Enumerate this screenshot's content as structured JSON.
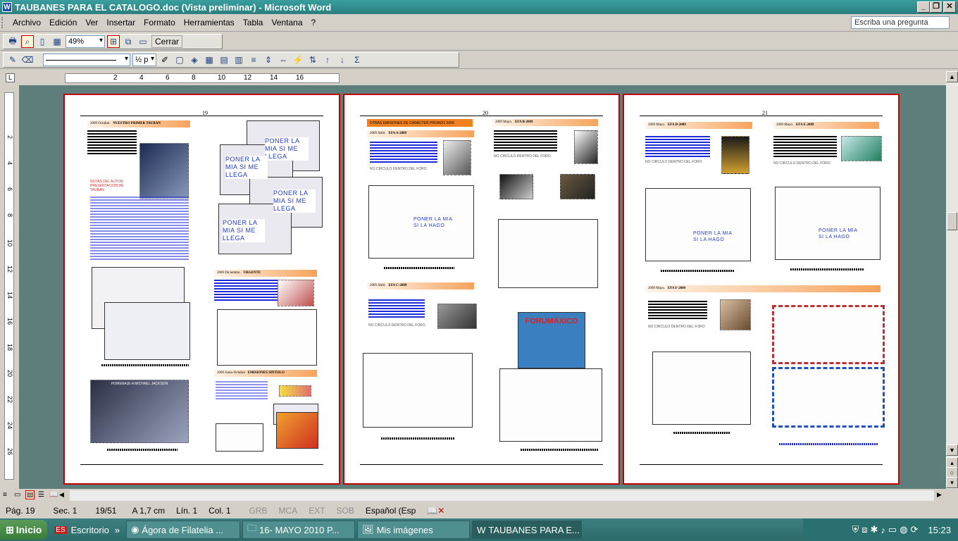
{
  "window": {
    "title": "TAUBANES PARA EL CATALOGO.doc (Vista preliminar) - Microsoft Word",
    "app_icon": "W"
  },
  "menu": [
    "Archivo",
    "Edición",
    "Ver",
    "Insertar",
    "Formato",
    "Herramientas",
    "Tabla",
    "Ventana",
    "?"
  ],
  "help_box": {
    "placeholder": "Escriba una pregunta"
  },
  "toolbar1": {
    "zoom": "49%",
    "close_label": "Cerrar"
  },
  "toolbar2": {
    "line_weight": "½ p"
  },
  "ruler_ticks": [
    "2",
    "4",
    "6",
    "8",
    "10",
    "12",
    "14",
    "16"
  ],
  "vruler_ticks": [
    "2",
    "4",
    "6",
    "8",
    "10",
    "12",
    "14",
    "16",
    "18",
    "20",
    "22",
    "24",
    "26"
  ],
  "pages": [
    {
      "number": "19",
      "sections": [
        "2009 Octubre.",
        "NUESTRO PRIMER TAUBAN",
        "2009 Diciembre.",
        "URGENTE",
        "2009 Junio-Octubre",
        "EMISIONES SINTOLO"
      ],
      "notes": [
        "NOTAS DEL AUTOR:",
        "PRESENTACION DE",
        "TAUBAN"
      ],
      "placeholders": [
        "PONER LA MIA SI ME LLEGA",
        "PONER LA MIA SI ME LLEGA",
        "PONER LA MIA SI ME LLEGA",
        "PONER LA MIA SI ME LLEGA"
      ],
      "miniature": "HOMENAJE A MICHAEL JACKSON"
    },
    {
      "number": "20",
      "sections": [
        "OTRAS EMISIONES DE CARÁCTER PRIVADO 2009",
        "2009 Abril.",
        "EFA A-2009",
        "2009 Mayo.",
        "EFA B-2009",
        "2009 Abril.",
        "EFA C-2009"
      ],
      "circulo": [
        "NO CIRCULO DENTRO DEL FORO",
        "NO CIRCULO DENTRO DEL FORO",
        "NO CIRCULO DENTRO DEL FORO"
      ],
      "placeholders": [
        "PONER LA MIA SI LA HAGO"
      ],
      "poster": "FORUMÁXICO"
    },
    {
      "number": "21",
      "sections": [
        "2009 Mayo.",
        "EFA D-2009",
        "2009 Mayo.",
        "EFA E-2009",
        "2009 Mayo.",
        "EFA F-2009"
      ],
      "circulo": [
        "NO CIRCULO DENTRO DEL FORO",
        "NO CIRCULO DENTRO DEL FORO",
        "NO CIRCULO DENTRO DEL FORO"
      ],
      "placeholders": [
        "PONER LA MIA SI LA HAGO",
        "PONER LA MIA SI LA HAGO"
      ]
    }
  ],
  "status": {
    "page": "Pág. 19",
    "sec": "Sec. 1",
    "pages": "19/51",
    "at": "A 1,7 cm",
    "line": "Lín. 1",
    "col": "Col. 1",
    "grb": "GRB",
    "mca": "MCA",
    "ext": "EXT",
    "sob": "SOB",
    "lang": "Español (Esp"
  },
  "taskbar": {
    "start": "Inicio",
    "items": [
      "Escritorio",
      "Ágora de Filatelia ...",
      "16- MAYO 2010 P...",
      "Mis imágenes",
      "TAUBANES PARA E..."
    ],
    "clock": "15:23"
  },
  "colors": {
    "title": "#2a7f7f",
    "workspace": "#5d7e7a",
    "page_border": "#c00000",
    "band": "#f7a35c",
    "placeholder": "#2038c8"
  }
}
